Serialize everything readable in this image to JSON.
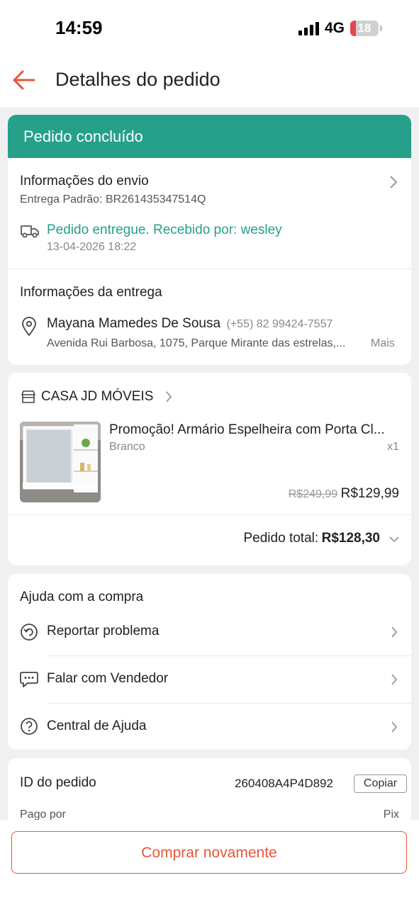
{
  "status_bar": {
    "time": "14:59",
    "network": "4G",
    "battery_level": "18"
  },
  "header": {
    "title": "Detalhes do pedido",
    "back_icon": "arrow-left-icon",
    "accent": "#e8553a"
  },
  "order_status": {
    "label": "Pedido concluído",
    "color": "#26a08a"
  },
  "shipping": {
    "title": "Informações do envio",
    "subtitle": "Entrega Padrão: BR261435347514Q",
    "delivery_status": "Pedido entregue. Recebido por: wesley",
    "delivery_time": "13-04-2026 18:22"
  },
  "delivery_info": {
    "title": "Informações da entrega",
    "name": "Mayana Mamedes De Sousa",
    "phone": "(+55) 82 99424-7557",
    "address": "Avenida Rui Barbosa, 1075, Parque Mirante das estrelas,...",
    "more": "Mais"
  },
  "shop": {
    "name": "CASA JD MÓVEIS",
    "product": {
      "name": "Promoção! Armário Espelheira com Porta Cl...",
      "variant": "Branco",
      "quantity": "x1",
      "original_price": "R$249,99",
      "price": "R$129,99"
    },
    "total_label": "Pedido total:",
    "total_value": "R$128,30"
  },
  "help": {
    "title": "Ajuda com a compra",
    "items": [
      {
        "label": "Reportar problema",
        "icon": "report-problem-icon"
      },
      {
        "label": "Falar com Vendedor",
        "icon": "chat-bubbles-icon"
      },
      {
        "label": "Central de Ajuda",
        "icon": "help-circle-icon"
      }
    ]
  },
  "order_info": {
    "id_label": "ID do pedido",
    "id_value": "260408A4P4D892",
    "copy_label": "Copiar",
    "paid_label": "Pago por",
    "paid_value": "Pix"
  },
  "footer": {
    "buy_again": "Comprar novamente"
  }
}
